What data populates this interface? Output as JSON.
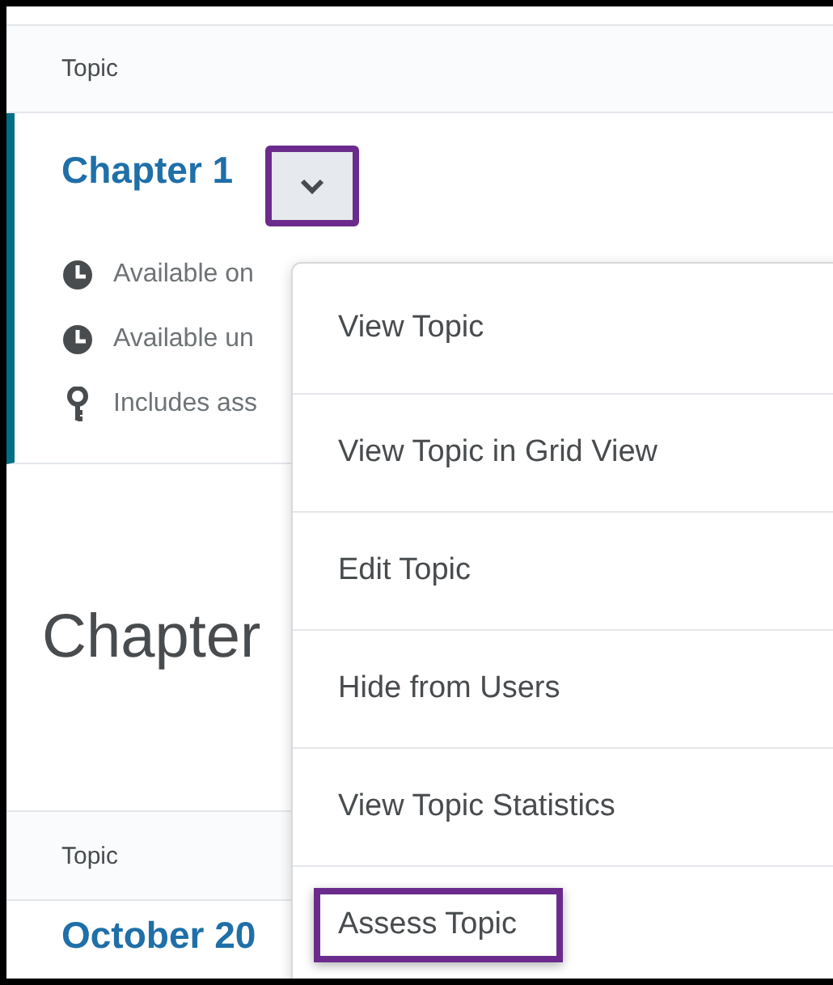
{
  "table_header": "Topic",
  "topic": {
    "title": "Chapter 1",
    "menu_button": {
      "highlighted": true
    },
    "details": [
      {
        "kind": "clock",
        "text": "Available on"
      },
      {
        "kind": "clock",
        "text": "Available un"
      },
      {
        "kind": "key",
        "text": "Includes ass"
      }
    ]
  },
  "section_heading": "Chapter",
  "section_table_header": "Topic",
  "section_first_topic": "October 20",
  "context_menu": [
    {
      "label": "View Topic",
      "highlighted": false
    },
    {
      "label": "View Topic in Grid View",
      "highlighted": false
    },
    {
      "label": "Edit Topic",
      "highlighted": false
    },
    {
      "label": "Hide from Users",
      "highlighted": false
    },
    {
      "label": "View Topic Statistics",
      "highlighted": false
    },
    {
      "label": "Assess Topic",
      "highlighted": true
    }
  ]
}
